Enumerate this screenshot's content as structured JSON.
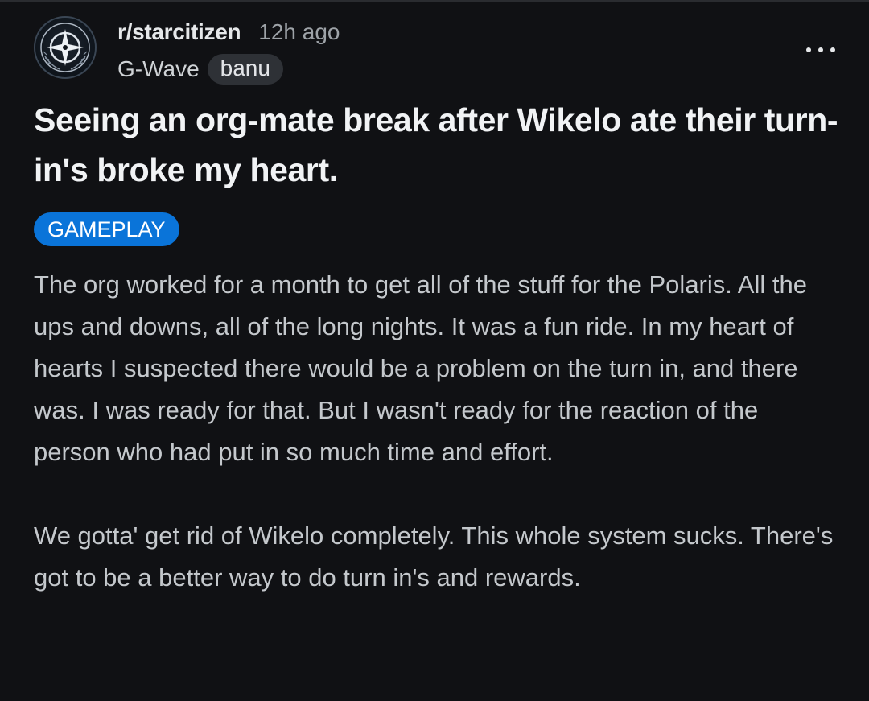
{
  "post": {
    "subreddit": "r/starcitizen",
    "time_ago": "12h ago",
    "username": "G-Wave",
    "user_flair": "banu",
    "title": "Seeing an org-mate break after Wikelo ate their turn-in's broke my heart.",
    "post_flair": "GAMEPLAY",
    "body": [
      "The org worked for a month to get all of the stuff for the Polaris. All the ups and downs, all of the long nights. It was a fun ride. In my heart of hearts I suspected there would be a problem on the turn in, and there was. I was ready for that. But I wasn't ready for the reaction of the person who had put in so much time and effort.",
      "We gotta' get rid of Wikelo completely. This whole system sucks. There's got to be a better way to do turn in's and rewards."
    ]
  },
  "icons": {
    "avatar": "star-citizen-logo-icon",
    "more": "more-options-icon"
  },
  "colors": {
    "background": "#101114",
    "post_flair_bg": "#0a74d9",
    "user_flair_bg": "#2e3136"
  }
}
